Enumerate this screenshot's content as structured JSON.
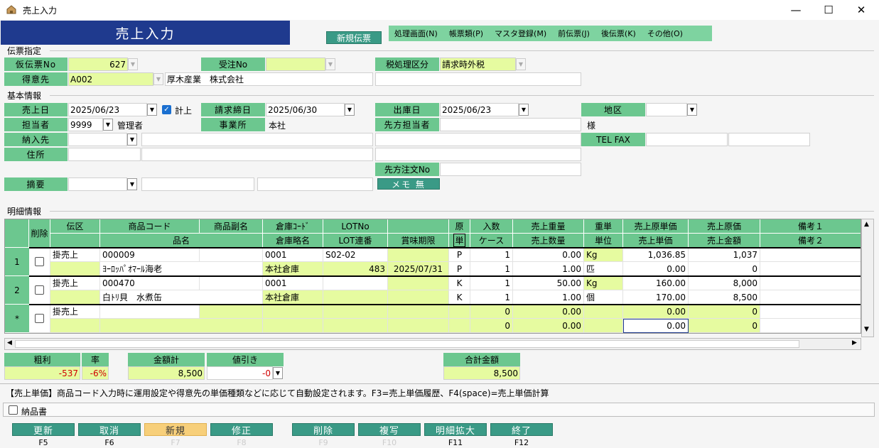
{
  "window": {
    "title": "売上入力",
    "minimize": "—",
    "maximize": "☐",
    "close": "✕"
  },
  "banner": "売上入力",
  "new_slip_button": "新規伝票",
  "menu": [
    "処理画面(N)",
    "帳票類(P)",
    "マスタ登録(M)",
    "前伝票(J)",
    "後伝票(K)",
    "その他(O)"
  ],
  "sections": {
    "slip": "伝票指定",
    "basic": "基本情報",
    "detail": "明細情報"
  },
  "slip": {
    "temp_no_label": "仮伝票No",
    "temp_no": "627",
    "order_no_label": "受注No",
    "order_no": "",
    "tax_label": "税処理区分",
    "tax": "請求時外税",
    "customer_label": "得意先",
    "customer_code": "A002",
    "customer_name": "厚木産業　株式会社"
  },
  "basic": {
    "sales_date_label": "売上日",
    "sales_date": "2025/06/23",
    "post_label": "計上",
    "closing_label": "請求締日",
    "closing_date": "2025/06/30",
    "ship_label": "出庫日",
    "ship_date": "2025/06/23",
    "area_label": "地区",
    "staff_label": "担当者",
    "staff_code": "9999",
    "staff_name": "管理者",
    "office_label": "事業所",
    "office": "本社",
    "contact_label": "先方担当者",
    "honorific": "様",
    "delivery_label": "納入先",
    "telfax_label": "TEL FAX",
    "address_label": "住所",
    "customer_order_label": "先方注文No",
    "summary_label": "摘要",
    "memo_button": "メモ 無"
  },
  "grid": {
    "headers_top": [
      "削除",
      "伝区",
      "商品コード",
      "商品副名",
      "倉庫ｺｰﾄﾞ",
      "LOTNo",
      "原",
      "入数",
      "売上重量",
      "重単",
      "売上原単価",
      "売上原価",
      "備考１"
    ],
    "headers_bottom": [
      "品名",
      "倉庫略名",
      "LOT連番",
      "賞味期限",
      "単",
      "ケース",
      "売上数量",
      "単位",
      "売上単価",
      "売上金額",
      "備考２"
    ],
    "rows": [
      {
        "no": "1",
        "kind": "掛売上",
        "code": "000009",
        "wh_code": "0001",
        "lot": "S02-02",
        "gen": "P",
        "irisu": "1",
        "weight": "0.00",
        "wunit": "Kg",
        "cost_price": "1,036.85",
        "cost": "1,037",
        "name": "ﾖｰﾛｯﾊﾟｵﾏｰﾙ海老",
        "wh_name": "本社倉庫",
        "lot_seq": "483",
        "expiry": "2025/07/31",
        "tan": "P",
        "case": "1",
        "qty": "1.00",
        "unit": "匹",
        "price": "0.00",
        "amount": "0"
      },
      {
        "no": "2",
        "kind": "掛売上",
        "code": "000470",
        "wh_code": "0001",
        "lot": "",
        "gen": "K",
        "irisu": "1",
        "weight": "50.00",
        "wunit": "Kg",
        "cost_price": "160.00",
        "cost": "8,000",
        "name": "白ﾄﾘ貝　水煮缶",
        "wh_name": "本社倉庫",
        "lot_seq": "",
        "expiry": "",
        "tan": "K",
        "case": "1",
        "qty": "1.00",
        "unit": "個",
        "price": "170.00",
        "amount": "8,500"
      },
      {
        "no": "*",
        "kind": "掛売上",
        "code": "",
        "wh_code": "",
        "lot": "",
        "gen": "",
        "irisu": "0",
        "weight": "0.00",
        "wunit": "",
        "cost_price": "0.00",
        "cost": "0",
        "name": "",
        "wh_name": "",
        "lot_seq": "",
        "expiry": "",
        "tan": "",
        "case": "0",
        "qty": "0.00",
        "unit": "",
        "price": "0.00",
        "amount": "0"
      }
    ]
  },
  "totals": {
    "gross_label": "粗利",
    "gross": "-537",
    "rate_label": "率",
    "rate": "-6%",
    "amount_label": "金額計",
    "amount": "8,500",
    "discount_label": "値引き",
    "discount": "-0",
    "grand_label": "合計金額",
    "grand": "8,500"
  },
  "hint": "【売上単価】商品コード入力時に運用設定や得意先の単価種類などに応じて自動設定されます。F3=売上単価履歴、F4(space)=売上単価計算",
  "delivery_note": "納品書",
  "fkeys": [
    {
      "label": "更新",
      "key": "F5"
    },
    {
      "label": "取消",
      "key": "F6"
    },
    {
      "label": "新規",
      "key": "F7"
    },
    {
      "label": "修正",
      "key": "F8"
    },
    {
      "label": "削除",
      "key": "F9"
    },
    {
      "label": "複写",
      "key": "F10"
    },
    {
      "label": "明細拡大",
      "key": "F11"
    },
    {
      "label": "終了",
      "key": "F12"
    }
  ],
  "colors": {
    "label_green": "#6cc78f",
    "input_yellow": "#e6fba0",
    "banner_blue": "#1f3a8e",
    "button_teal": "#3a9a86"
  }
}
